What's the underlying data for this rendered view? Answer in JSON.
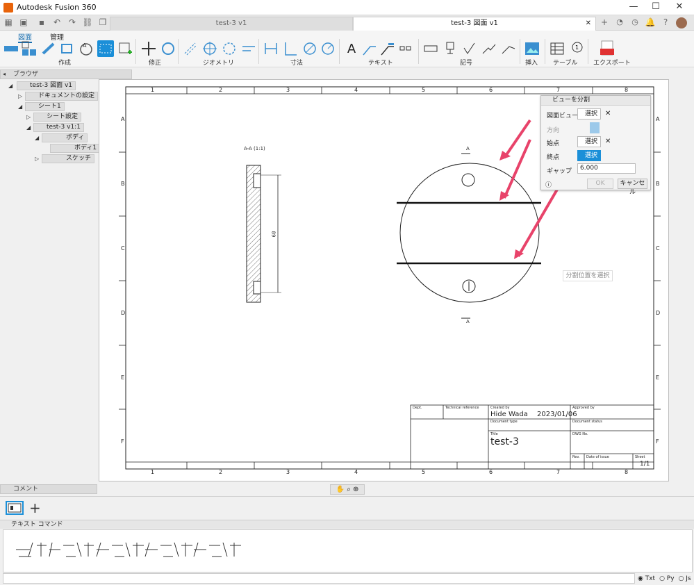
{
  "app": {
    "title": "Autodesk Fusion 360"
  },
  "window_controls": {
    "minimize": "—",
    "maximize": "☐",
    "close": "✕"
  },
  "tabs": [
    {
      "label": "test-3 v1",
      "active": false
    },
    {
      "label": "test-3 図面 v1",
      "active": true
    }
  ],
  "ribbon": {
    "tabs": [
      "図面",
      "管理"
    ],
    "groups": [
      "作成",
      "修正",
      "ジオメトリ",
      "寸法",
      "テキスト",
      "記号",
      "挿入",
      "テーブル",
      "エクスポート"
    ]
  },
  "browser": {
    "title": "ブラウザ",
    "items": [
      "test-3 図面 v1",
      "ドキュメントの設定",
      "シート1",
      "シート設定",
      "test-3 v1:1",
      "ボディ",
      "ボディ1",
      "スケッチ"
    ]
  },
  "drawing": {
    "col_labels": [
      "1",
      "2",
      "3",
      "4",
      "5",
      "6",
      "7",
      "8"
    ],
    "row_labels": [
      "A",
      "B",
      "C",
      "D",
      "E",
      "F"
    ],
    "section_label": "A-A (1:1)",
    "dimension": "89",
    "section_mark": "A"
  },
  "titleblock": {
    "dept": "Dept.",
    "tech_ref": "Technical reference",
    "created_by_label": "Created by",
    "created_by": "Hide Wada",
    "created_date": "2023/01/06",
    "approved_by": "Approved by",
    "doc_type": "Document type",
    "doc_status": "Document status",
    "title_label": "Title",
    "title": "test-3",
    "dwg_no": "DWG No.",
    "rev": "Rev.",
    "date_issue": "Date of issue",
    "sheet_label": "Sheet",
    "sheet": "1/1"
  },
  "dialog": {
    "title": "ビューを分割",
    "rows": [
      {
        "label": "図面ビュー",
        "button": "選択",
        "active": false
      },
      {
        "label": "方向",
        "button": "",
        "active": false
      },
      {
        "label": "始点",
        "button": "選択",
        "active": false
      },
      {
        "label": "終点",
        "button": "選択",
        "active": true
      }
    ],
    "gap_label": "ギャップ",
    "gap_value": "6.000",
    "ok": "OK",
    "cancel": "キャンセル"
  },
  "hint": "分割位置を選択",
  "comment": "コメント",
  "textcommand": {
    "title": "テキスト コマンド",
    "modes": [
      "Txt",
      "Py",
      "Js"
    ],
    "selected_mode": "Txt"
  },
  "colors": {
    "accent": "#1b8fd8",
    "arrow": "#e8436a"
  }
}
